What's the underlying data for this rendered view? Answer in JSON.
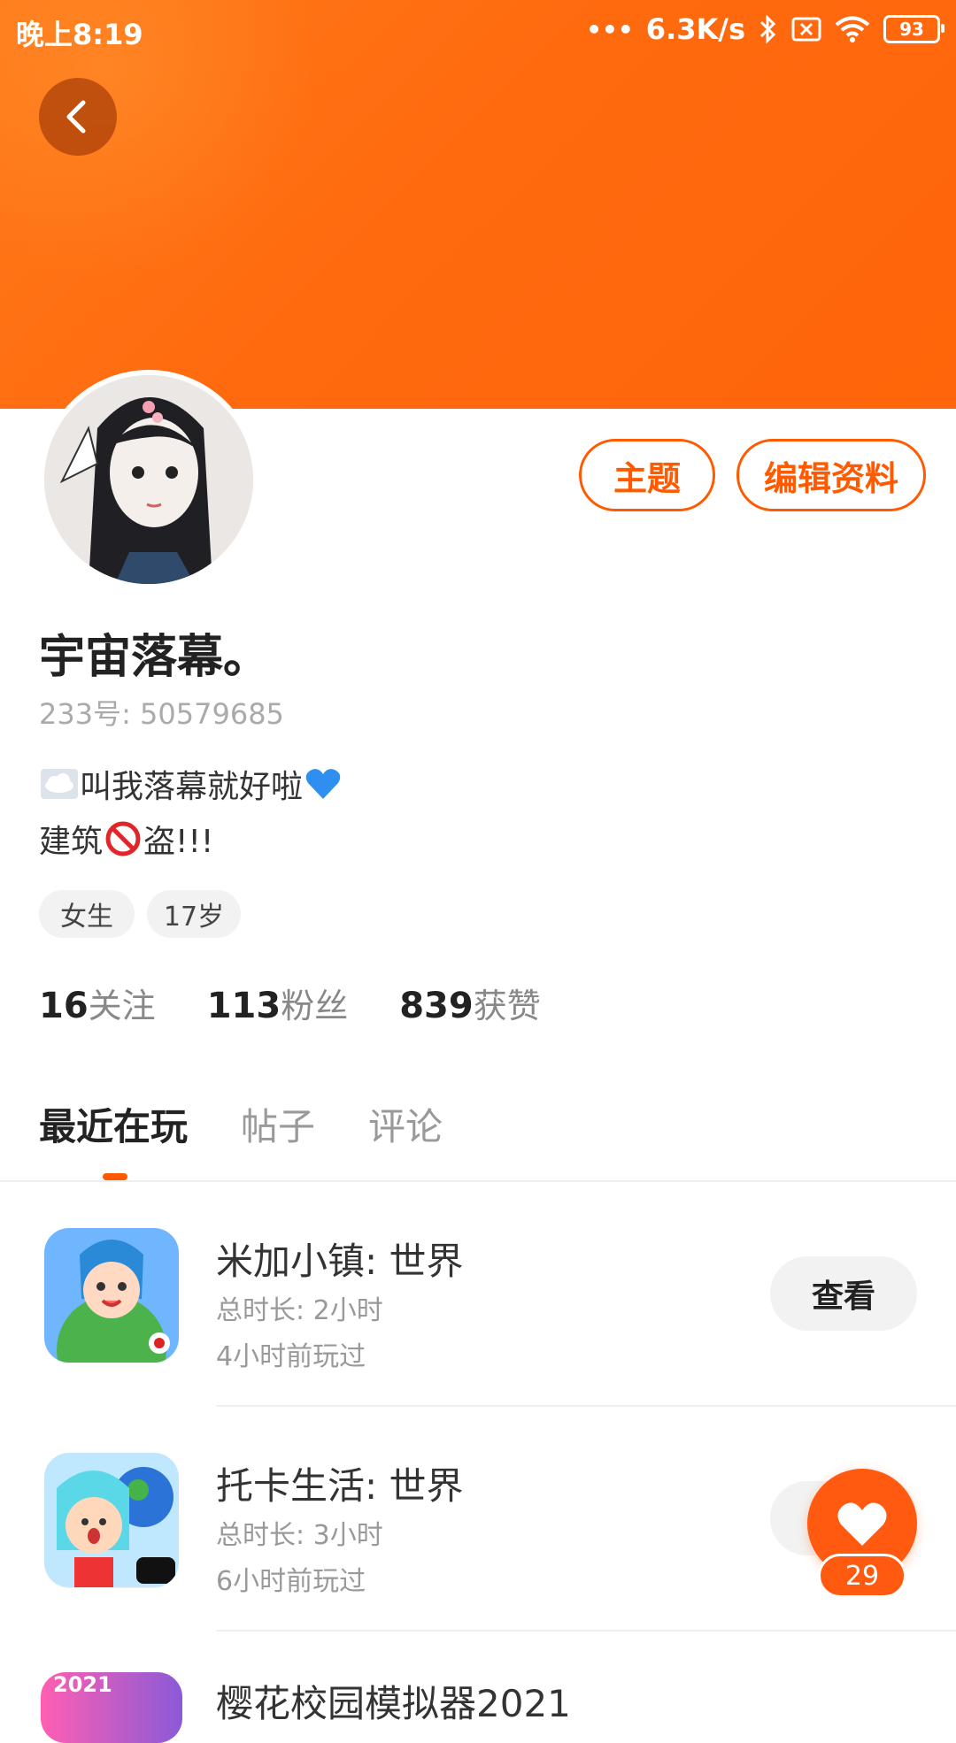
{
  "status_bar": {
    "time": "晚上8:19",
    "net_speed": "6.3K/s",
    "battery": "93"
  },
  "profile": {
    "theme_button": "主题",
    "edit_button": "编辑资料",
    "name": "宇宙落幕。",
    "id_label": "233号: 50579685",
    "bio_line1": "叫我落幕就好啦",
    "bio_line2_prefix": "建筑",
    "bio_line2_suffix": "盗!!!",
    "tags": [
      "女生",
      "17岁"
    ],
    "stats": [
      {
        "num": "16",
        "label": "关注"
      },
      {
        "num": "113",
        "label": "粉丝"
      },
      {
        "num": "839",
        "label": "获赞"
      }
    ]
  },
  "tabs": [
    "最近在玩",
    "帖子",
    "评论"
  ],
  "games": [
    {
      "title": "米加小镇: 世界",
      "duration": "总时长: 2小时",
      "last_played": "4小时前玩过",
      "button": "查看"
    },
    {
      "title": "托卡生活: 世界",
      "duration": "总时长: 3小时",
      "last_played": "6小时前玩过",
      "button": ""
    },
    {
      "title": "樱花校园模拟器2021",
      "badge": "2021"
    }
  ],
  "fab": {
    "count": "29"
  },
  "colors": {
    "accent": "#ff5a00",
    "header_start": "#ff7a1a",
    "header_end": "#ff650a"
  }
}
